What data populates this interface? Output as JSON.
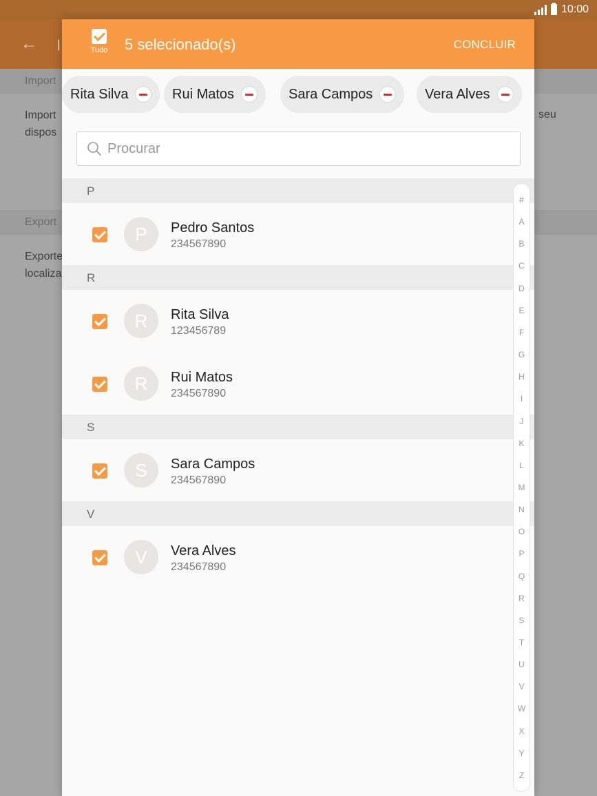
{
  "status_bar": {
    "time": "10:00"
  },
  "background": {
    "title": "I",
    "sections": [
      {
        "header": "Import",
        "text_lines": [
          "Import",
          "dispos"
        ],
        "text_right": "seu"
      },
      {
        "header": "Export",
        "text_lines": [
          "Exporte",
          "localiza"
        ]
      }
    ]
  },
  "dialog": {
    "select_all_label": "Tudo",
    "title": "5 selecionado(s)",
    "done_label": "CONCLUIR",
    "chips": [
      "Rita Silva",
      "Rui Matos",
      "Sara Campos",
      "Vera Alves"
    ],
    "search_placeholder": "Procurar",
    "groups": [
      {
        "letter": "P",
        "contacts": [
          {
            "initial": "P",
            "name": "Pedro Santos",
            "phone": "234567890",
            "checked": true
          }
        ]
      },
      {
        "letter": "R",
        "contacts": [
          {
            "initial": "R",
            "name": "Rita Silva",
            "phone": "123456789",
            "checked": true
          },
          {
            "initial": "R",
            "name": "Rui Matos",
            "phone": "234567890",
            "checked": true
          }
        ]
      },
      {
        "letter": "S",
        "contacts": [
          {
            "initial": "S",
            "name": "Sara Campos",
            "phone": "234567890",
            "checked": true
          }
        ]
      },
      {
        "letter": "V",
        "contacts": [
          {
            "initial": "V",
            "name": "Vera Alves",
            "phone": "234567890",
            "checked": true
          }
        ]
      }
    ],
    "index_letters": [
      "#",
      "A",
      "B",
      "C",
      "D",
      "E",
      "F",
      "G",
      "H",
      "I",
      "J",
      "K",
      "L",
      "M",
      "N",
      "O",
      "P",
      "Q",
      "R",
      "S",
      "T",
      "U",
      "V",
      "W",
      "X",
      "Y",
      "Z"
    ]
  },
  "colors": {
    "accent": "#f89a44",
    "remove_red": "#d0312d",
    "status_bar": "#a8682e"
  }
}
